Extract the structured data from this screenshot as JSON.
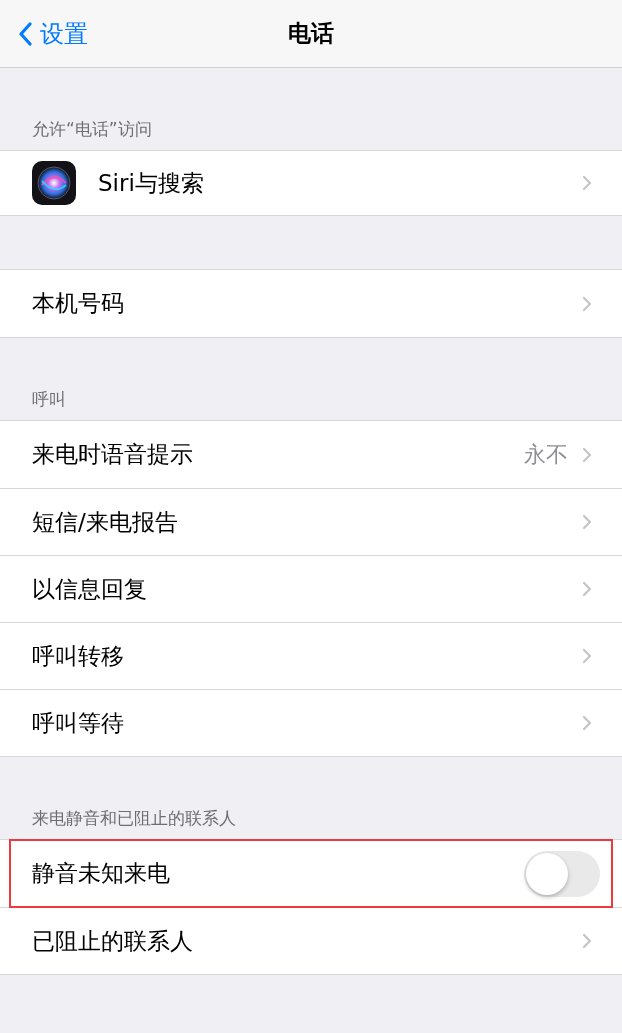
{
  "nav": {
    "back": "设置",
    "title": "电话"
  },
  "sections": [
    {
      "header": "允许“电话”访问",
      "rows": [
        {
          "kind": "icon-link",
          "label": "Siri与搜索"
        }
      ]
    },
    {
      "rows": [
        {
          "kind": "link",
          "label": "本机号码"
        }
      ]
    },
    {
      "header": "呼叫",
      "rows": [
        {
          "kind": "link",
          "label": "来电时语音提示",
          "value": "永不"
        },
        {
          "kind": "link",
          "label": "短信/来电报告"
        },
        {
          "kind": "link",
          "label": "以信息回复"
        },
        {
          "kind": "link",
          "label": "呼叫转移"
        },
        {
          "kind": "link",
          "label": "呼叫等待"
        }
      ]
    },
    {
      "header": "来电静音和已阻止的联系人",
      "rows": [
        {
          "kind": "toggle",
          "label": "静音未知来电",
          "on": false,
          "highlighted": true
        },
        {
          "kind": "link",
          "label": "已阻止的联系人"
        }
      ]
    }
  ]
}
